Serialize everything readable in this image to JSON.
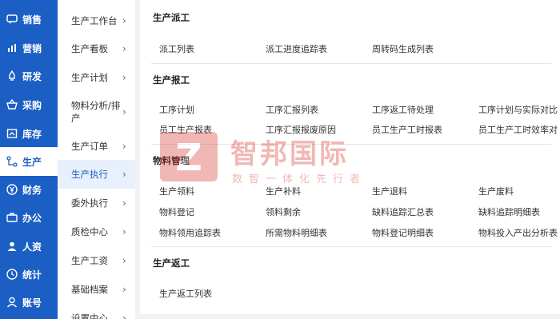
{
  "nav_primary": [
    {
      "label": "销售",
      "icon": "chat-icon"
    },
    {
      "label": "营销",
      "icon": "bar-chart-icon"
    },
    {
      "label": "研发",
      "icon": "rocket-icon"
    },
    {
      "label": "采购",
      "icon": "basket-icon"
    },
    {
      "label": "库存",
      "icon": "inventory-icon"
    },
    {
      "label": "生产",
      "icon": "workflow-icon",
      "active": true
    },
    {
      "label": "财务",
      "icon": "yen-icon"
    },
    {
      "label": "办公",
      "icon": "briefcase-icon"
    },
    {
      "label": "人资",
      "icon": "user-icon"
    },
    {
      "label": "统计",
      "icon": "clock-icon"
    },
    {
      "label": "账号",
      "icon": "person-icon"
    }
  ],
  "nav_secondary": [
    {
      "label": "生产工作台"
    },
    {
      "label": "生产看板"
    },
    {
      "label": "生产计划"
    },
    {
      "label": "物料分析/排产"
    },
    {
      "label": "生产订单"
    },
    {
      "label": "生产执行",
      "active": true
    },
    {
      "label": "委外执行"
    },
    {
      "label": "质检中心"
    },
    {
      "label": "生产工资"
    },
    {
      "label": "基础档案"
    },
    {
      "label": "设置中心"
    }
  ],
  "sections": [
    {
      "title": "生产派工",
      "rows": [
        [
          "派工列表",
          "派工进度追踪表",
          "周转码生成列表"
        ]
      ]
    },
    {
      "title": "生产报工",
      "rows": [
        [
          "工序计划",
          "工序汇报列表",
          "工序返工待处理",
          "工序计划与实际对比"
        ],
        [
          "员工生产报表",
          "工序汇报报废原因",
          "员工生产工时报表",
          "员工生产工时效率对"
        ]
      ]
    },
    {
      "title": "物料管理",
      "rows": [
        [
          "生产领料",
          "生产补料",
          "生产退料",
          "生产废料"
        ],
        [
          "物料登记",
          "领料剩余",
          "缺料追踪汇总表",
          "缺料追踪明细表"
        ],
        [
          "物料领用追踪表",
          "所需物料明细表",
          "物料登记明细表",
          "物料投入产出分析表"
        ]
      ]
    },
    {
      "title": "生产返工",
      "rows": [
        [
          "生产返工列表"
        ]
      ]
    }
  ],
  "watermark": {
    "mark": "Z",
    "text": "智邦国际",
    "sub": "数智一体化先行者"
  },
  "colors": {
    "nav_blue": "#1b5fc4",
    "watermark_red": "#d9342b"
  }
}
